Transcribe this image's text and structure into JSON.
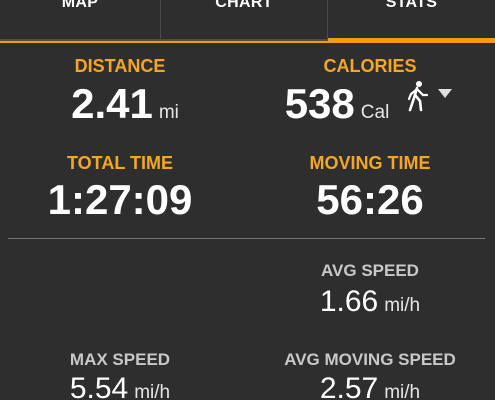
{
  "tabs": [
    {
      "label": "MAP"
    },
    {
      "label": "CHART"
    },
    {
      "label": "STATS"
    }
  ],
  "active_tab": "STATS",
  "accent_color": "#f39c12",
  "distance": {
    "label": "DISTANCE",
    "value": "2.41",
    "unit": "mi"
  },
  "calories": {
    "label": "CALORIES",
    "value": "538",
    "unit": "Cal",
    "activity_icon": "walking-person-icon",
    "dropdown_icon": "triangle-down-icon"
  },
  "total_time": {
    "label": "TOTAL TIME",
    "value": "1:27:09"
  },
  "moving_time": {
    "label": "MOVING TIME",
    "value": "56:26"
  },
  "avg_speed": {
    "label": "AVG SPEED",
    "value": "1.66",
    "unit": "mi/h"
  },
  "max_speed": {
    "label": "MAX SPEED",
    "value": "5.54",
    "unit": "mi/h"
  },
  "avg_moving_speed": {
    "label": "AVG MOVING SPEED",
    "value": "2.57",
    "unit": "mi/h"
  }
}
